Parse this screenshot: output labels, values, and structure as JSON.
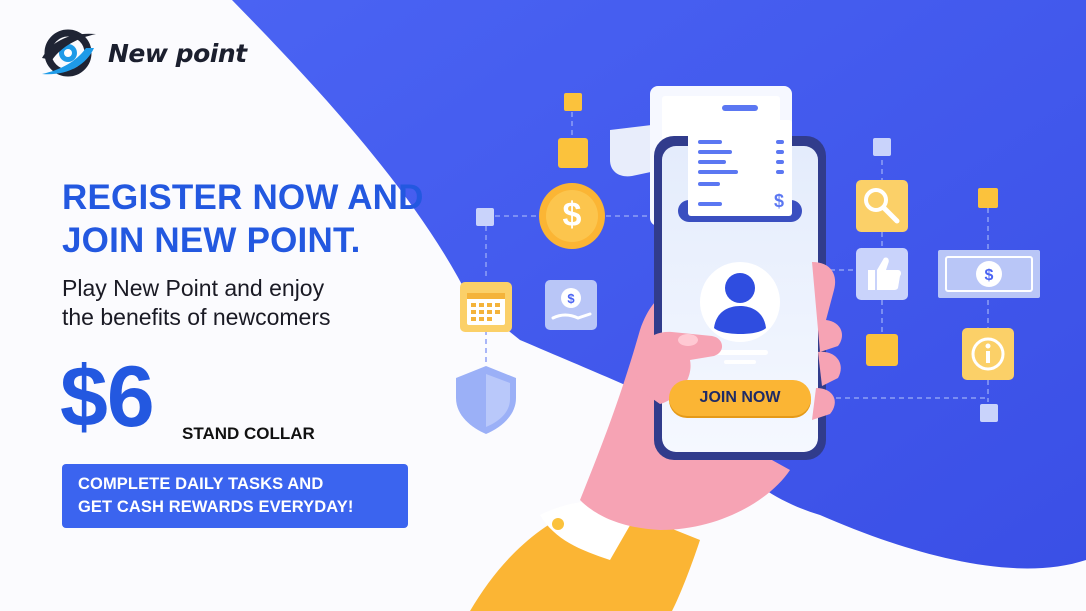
{
  "brand": {
    "name": "New point"
  },
  "headline": {
    "line1": "REGISTER NOW AND",
    "line2": "JOIN NEW POINT."
  },
  "subline": {
    "line1": "Play New Point and enjoy",
    "line2": "the benefits of newcomers"
  },
  "offer": {
    "amount": "$6",
    "unit": "STAND COLLAR"
  },
  "banner": {
    "line1": "COMPLETE DAILY TASKS AND",
    "line2": "GET CASH REWARDS EVERYDAY!"
  },
  "phone": {
    "join_button_label": "JOIN NOW"
  },
  "icons": {
    "dollar_symbol": "$",
    "info_symbol": "i"
  },
  "colors": {
    "primary_blue": "#2358e0",
    "background_blue": "#3f5cf0",
    "accent_yellow": "#fbb534",
    "skin_pink": "#f7a7b4",
    "banner_blue": "#3b64ef"
  }
}
